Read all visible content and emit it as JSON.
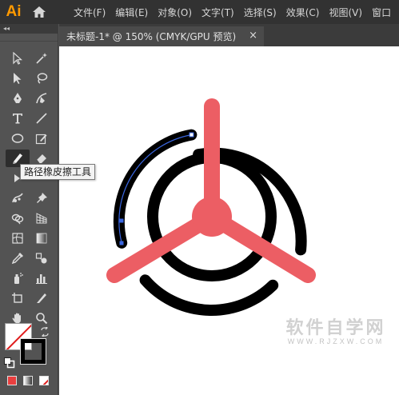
{
  "app": {
    "logo_text": "Ai",
    "menus": [
      "文件(F)",
      "编辑(E)",
      "对象(O)",
      "文字(T)",
      "选择(S)",
      "效果(C)",
      "视图(V)",
      "窗口"
    ]
  },
  "toolbar": {
    "collapse_label": "◂◂",
    "active_tool": "path-eraser-tool"
  },
  "document_tab": {
    "title": "未标题-1* @ 150% (CMYK/GPU 预览)",
    "close_label": "×"
  },
  "tooltip": {
    "text": "路径橡皮擦工具"
  },
  "watermark": {
    "text_cn": "软件自学网",
    "text_en": "WWW.RJZXW.COM"
  },
  "colors": {
    "accent_red": "#ec5e64",
    "stroke_black": "#000000",
    "selection_blue": "#3a66e0",
    "app_orange": "#ff9a00"
  }
}
